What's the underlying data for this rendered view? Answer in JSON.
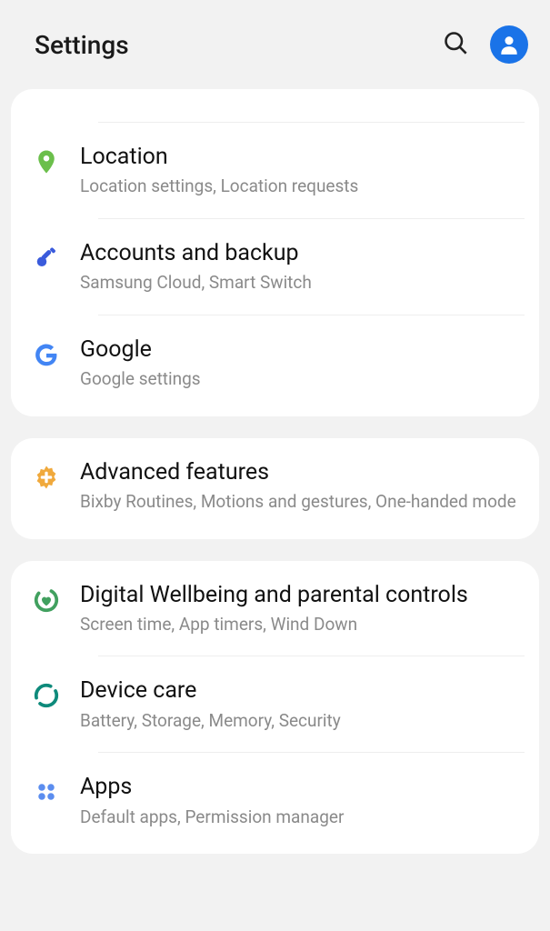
{
  "header": {
    "title": "Settings"
  },
  "groups": [
    {
      "items": [
        {
          "icon": "shield-permission",
          "title": "",
          "subtitle": ""
        },
        {
          "icon": "location-pin",
          "title": "Location",
          "subtitle": "Location settings, Location requests"
        },
        {
          "icon": "key",
          "title": "Accounts and backup",
          "subtitle": "Samsung Cloud, Smart Switch"
        },
        {
          "icon": "google-g",
          "title": "Google",
          "subtitle": "Google settings"
        }
      ]
    },
    {
      "items": [
        {
          "icon": "plus-gear",
          "title": "Advanced features",
          "subtitle": "Bixby Routines, Motions and gestures, One-handed mode"
        }
      ]
    },
    {
      "items": [
        {
          "icon": "wellbeing-heart",
          "title": "Digital Wellbeing and parental controls",
          "subtitle": "Screen time, App timers, Wind Down"
        },
        {
          "icon": "device-care",
          "title": "Device care",
          "subtitle": "Battery, Storage, Memory, Security"
        },
        {
          "icon": "apps-grid",
          "title": "Apps",
          "subtitle": "Default apps, Permission manager"
        }
      ]
    }
  ]
}
